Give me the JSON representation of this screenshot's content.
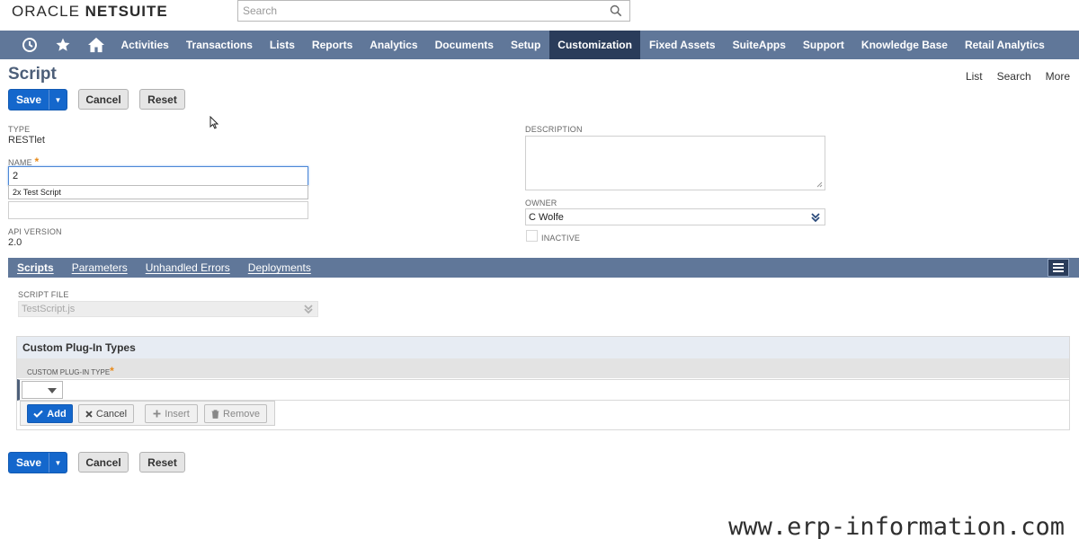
{
  "brand": {
    "oracle": "ORACLE",
    "netsuite": "NETSUITE"
  },
  "search": {
    "placeholder": "Search"
  },
  "nav": {
    "items": [
      "Activities",
      "Transactions",
      "Lists",
      "Reports",
      "Analytics",
      "Documents",
      "Setup",
      "Customization",
      "Fixed Assets",
      "SuiteApps",
      "Support",
      "Knowledge Base",
      "Retail Analytics"
    ],
    "active": "Customization"
  },
  "page": {
    "title": "Script"
  },
  "toplinks": {
    "list": "List",
    "search": "Search",
    "more": "More"
  },
  "buttons": {
    "save": "Save",
    "cancel": "Cancel",
    "reset": "Reset"
  },
  "fields": {
    "type_label": "TYPE",
    "type_value": "RESTlet",
    "name_label": "NAME",
    "name_required": "*",
    "name_value": "2",
    "name_suggestion": "2x Test Script",
    "api_label": "API VERSION",
    "api_value": "2.0",
    "description_label": "DESCRIPTION",
    "owner_label": "OWNER",
    "owner_value": "C Wolfe",
    "inactive_label": "INACTIVE"
  },
  "subtabs": [
    "Scripts",
    "Parameters",
    "Unhandled Errors",
    "Deployments"
  ],
  "script_file": {
    "label": "SCRIPT FILE",
    "value": "TestScript.js"
  },
  "plugin": {
    "title": "Custom Plug-In Types",
    "column": "CUSTOM PLUG-IN TYPE",
    "column_required": "*",
    "add": "Add",
    "cancel": "Cancel",
    "insert": "Insert",
    "remove": "Remove"
  },
  "watermark": "www.erp-information.com",
  "colors": {
    "nav": "#607799",
    "nav_active": "#2a3c5a",
    "primary_button": "#1467cc",
    "title": "#4d5f79"
  }
}
